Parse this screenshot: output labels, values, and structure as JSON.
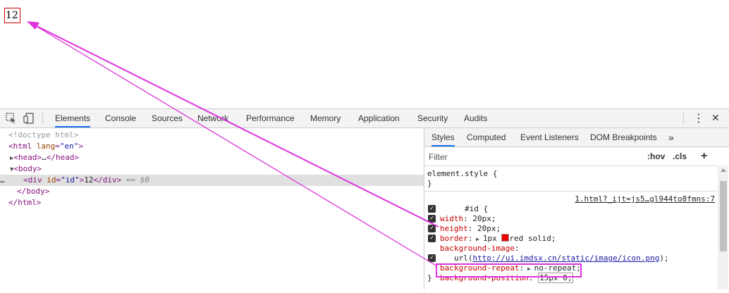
{
  "page": {
    "div_text": "12"
  },
  "devtools": {
    "main_tabs": [
      "Elements",
      "Console",
      "Sources",
      "Network",
      "Performance",
      "Memory",
      "Application",
      "Security",
      "Audits"
    ],
    "menu_glyph": "⋮",
    "close_glyph": "✕"
  },
  "elements": {
    "doctype": "<!doctype html>",
    "html_open_tag": "html",
    "html_attr": "lang",
    "html_val": "\"en\"",
    "head": "head",
    "head_ellipsis": "…",
    "body": "body",
    "div_tag": "div",
    "div_attr": "id",
    "div_val": "\"id\"",
    "div_text": "12",
    "selected_marker": "== $0",
    "dots": "…"
  },
  "styles": {
    "sub_tabs": [
      "Styles",
      "Computed",
      "Event Listeners",
      "DOM Breakpoints"
    ],
    "more_tabs": "»",
    "filter_placeholder": "Filter",
    "hov": ":hov",
    "cls": ".cls",
    "add": "+",
    "element_style": "element.style {",
    "close_brace": "}",
    "selector": "#id {",
    "source": "1.html?_ijt=js5…gl944to8fmns:7",
    "props": [
      {
        "name": "width",
        "value": "20px;"
      },
      {
        "name": "height",
        "value": "20px;"
      },
      {
        "name": "border",
        "value": "1px",
        "value2": "red solid;"
      },
      {
        "name": "background-image",
        "value": ""
      },
      {
        "url_prefix": "url(",
        "url": "http://ui.imdsx.cn/static/image/icon.png",
        "url_suffix": ");"
      },
      {
        "name": "background-repeat",
        "value": "no-repeat;"
      },
      {
        "name": "background-position",
        "value": "15px 0;"
      }
    ]
  },
  "colors": {
    "accent": "#1a73e8",
    "annotation": "#dd33dd",
    "swatch": "#ee0000"
  }
}
